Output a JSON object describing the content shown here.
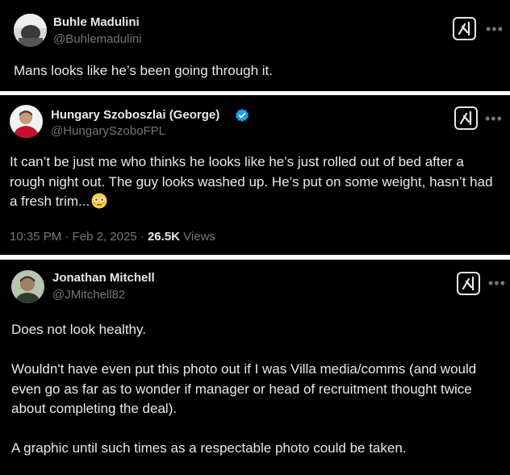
{
  "tweets": [
    {
      "display_name": "Buhle Madulini",
      "handle": "@Buhlemadulini",
      "text": "Mans looks like he’s been going through it."
    },
    {
      "display_name": "Hungary Szoboszlai (George)",
      "handle": "@HungarySzoboFPL",
      "verified": true,
      "text": "It can’t be just me who thinks he looks like he’s just rolled out of bed after a rough night out. The guy looks washed up. He’s put on some weight, hasn’t had a fresh trim...",
      "emoji": "flushed-face",
      "time": "10:35 PM",
      "date": "Feb 2, 2025",
      "views_count": "26.5K",
      "views_label": "Views"
    },
    {
      "display_name": "Jonathan Mitchell",
      "handle": "@JMitchell82",
      "text": "Does not look healthy.\n\nWouldn't have even put this photo out if I was Villa media/comms (and would even go as far as to wonder if manager or head of recruitment thought twice about completing the deal).\n\nA graphic until such times as a respectable photo could be taken."
    }
  ],
  "ui": {
    "more_label": "•••",
    "separator": "·"
  },
  "colors": {
    "background": "#000000",
    "primary_text": "#e7e9ea",
    "secondary_text": "#71767b",
    "verified_badge": "#1d9bf0",
    "divider": "#ffffff"
  }
}
